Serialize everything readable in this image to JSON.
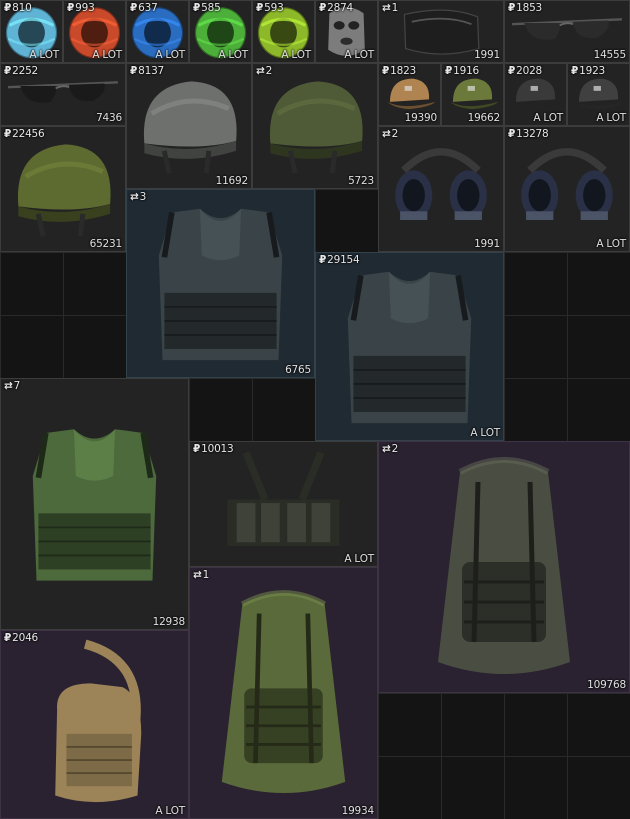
{
  "currency_symbol": "₽",
  "swap_symbol": "⇄",
  "items": [
    {
      "id": "armband-blue",
      "tag": "810",
      "value": "A LOT",
      "kind": "armband",
      "color": "#5fb4d6"
    },
    {
      "id": "armband-red",
      "tag": "993",
      "value": "A LOT",
      "kind": "armband",
      "color": "#c84a2a"
    },
    {
      "id": "armband-blue2",
      "tag": "637",
      "value": "A LOT",
      "kind": "armband",
      "color": "#2a6cc0"
    },
    {
      "id": "armband-green",
      "tag": "585",
      "value": "A LOT",
      "kind": "armband",
      "color": "#4caf3a"
    },
    {
      "id": "armband-yellowgreen",
      "tag": "593",
      "value": "A LOT",
      "kind": "armband",
      "color": "#8cb82a"
    },
    {
      "id": "balaclava",
      "tag": "2874",
      "value": "A LOT",
      "kind": "mask",
      "color": "#7c7c7c"
    },
    {
      "id": "face-shield-black",
      "tag": "1",
      "tag_type": "swap",
      "value": "1991",
      "kind": "goggles",
      "color": "#1e1e1e"
    },
    {
      "id": "sunglasses-1",
      "tag": "1853",
      "value": "14555",
      "kind": "glasses",
      "color": "#2b2b2b"
    },
    {
      "id": "sunglasses-2",
      "tag": "2252",
      "value": "7436",
      "kind": "glasses",
      "color": "#1a1a1a"
    },
    {
      "id": "helmet-grey",
      "tag": "8137",
      "value": "11692",
      "kind": "helmet",
      "color": "#6d706c"
    },
    {
      "id": "helmet-green-small",
      "tag": "2",
      "tag_type": "swap",
      "value": "5723",
      "kind": "helmet",
      "color": "#4f5a36"
    },
    {
      "id": "cap-tan",
      "tag": "1823",
      "value": "19390",
      "kind": "cap",
      "color": "#b08450"
    },
    {
      "id": "cap-olive",
      "tag": "1916",
      "value": "19662",
      "kind": "cap",
      "color": "#6b7a3a"
    },
    {
      "id": "cap-black",
      "tag": "2028",
      "value": "A LOT",
      "kind": "cap",
      "color": "#3a3a3a"
    },
    {
      "id": "cap-black-2",
      "tag": "1923",
      "value": "A LOT",
      "kind": "cap",
      "color": "#404040"
    },
    {
      "id": "helmet-green",
      "tag": "22456",
      "value": "65231",
      "kind": "helmet",
      "color": "#5d6a30"
    },
    {
      "id": "headset-1",
      "tag": "2",
      "tag_type": "swap",
      "value": "1991",
      "kind": "headset",
      "color": "#2a3046"
    },
    {
      "id": "headset-2",
      "tag": "13278",
      "value": "A LOT",
      "kind": "headset",
      "color": "#2a3046"
    },
    {
      "id": "armor-vest-1",
      "tag": "3",
      "tag_type": "swap",
      "value": "6765",
      "kind": "vest",
      "color": "#3a4448"
    },
    {
      "id": "armor-vest-2",
      "tag": "29154",
      "value": "A LOT",
      "kind": "vest",
      "color": "#3a4448"
    },
    {
      "id": "armor-camo",
      "tag": "7",
      "tag_type": "swap",
      "value": "12938",
      "kind": "vest",
      "color": "#4c6a3c"
    },
    {
      "id": "chest-rig",
      "tag": "10013",
      "value": "A LOT",
      "kind": "rig",
      "color": "#2a2c26"
    },
    {
      "id": "backpack-large",
      "tag": "2",
      "tag_type": "swap",
      "value": "109768",
      "kind": "backpack",
      "color": "#4a4e42"
    },
    {
      "id": "sling-bag",
      "tag": "2046",
      "value": "A LOT",
      "kind": "sling",
      "color": "#9c8458"
    },
    {
      "id": "backpack-green",
      "tag": "1",
      "tag_type": "swap",
      "value": "19934",
      "kind": "backpack",
      "color": "#5a6a3a"
    }
  ]
}
